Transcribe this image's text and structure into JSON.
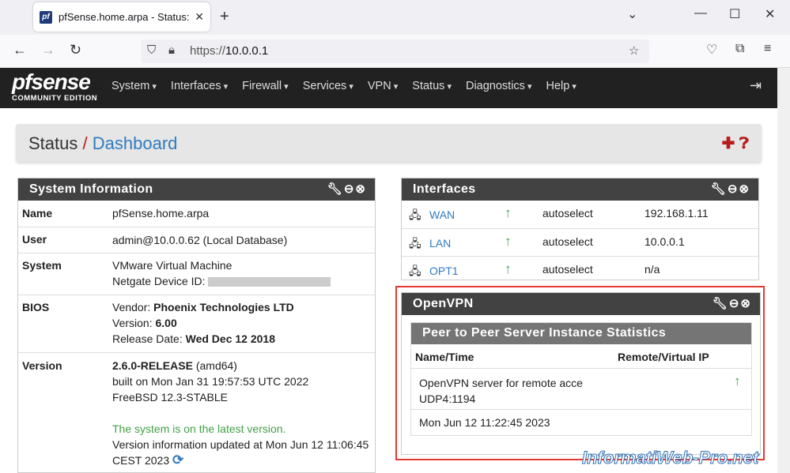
{
  "browser": {
    "tab_title": "pfSense.home.arpa - Status: Da",
    "favicon": "pf",
    "url_scheme": "https://",
    "url_host": "10.0.0.1"
  },
  "nav": {
    "logo": "pfsense",
    "logo_sub": "COMMUNITY EDITION",
    "menu": [
      "System",
      "Interfaces",
      "Firewall",
      "Services",
      "VPN",
      "Status",
      "Diagnostics",
      "Help"
    ]
  },
  "breadcrumb": {
    "root": "Status",
    "sep": "/",
    "page": "Dashboard"
  },
  "sysinfo": {
    "title": "System Information",
    "name_label": "Name",
    "name": "pfSense.home.arpa",
    "user_label": "User",
    "user": "admin@10.0.0.62 (Local Database)",
    "system_label": "System",
    "system": "VMware Virtual Machine",
    "netgate_label": "Netgate Device ID:",
    "bios_label": "BIOS",
    "bios_vendor_label": "Vendor:",
    "bios_vendor": "Phoenix Technologies LTD",
    "bios_version_label": "Version:",
    "bios_version": "6.00",
    "bios_date_label": "Release Date:",
    "bios_date": "Wed Dec 12 2018",
    "version_label": "Version",
    "version": "2.6.0-RELEASE",
    "version_arch": "(amd64)",
    "built": "built on Mon Jan 31 19:57:53 UTC 2022",
    "freebsd": "FreeBSD 12.3-STABLE",
    "latest": "The system is on the latest version.",
    "updated": "Version information updated at Mon Jun 12 11:06:45",
    "updated2": "CEST 2023"
  },
  "interfaces": {
    "title": "Interfaces",
    "rows": [
      {
        "name": "WAN",
        "media": "autoselect",
        "ip": "192.168.1.11"
      },
      {
        "name": "LAN",
        "media": "autoselect",
        "ip": "10.0.0.1"
      },
      {
        "name": "OPT1",
        "media": "autoselect",
        "ip": "n/a"
      }
    ]
  },
  "openvpn": {
    "title": "OpenVPN",
    "sub_title": "Peer to Peer Server Instance Statistics",
    "col1": "Name/Time",
    "col2": "Remote/Virtual IP",
    "server": "OpenVPN server for remote acce",
    "proto": "UDP4:1194",
    "time": "Mon Jun 12 11:22:45 2023"
  },
  "watermark": "InformatiWeb-Pro.net",
  "colors": {
    "accent": "#2f7bbf",
    "nav_bg": "#212121",
    "status_up": "#43a047",
    "highlight": "#e53935"
  }
}
